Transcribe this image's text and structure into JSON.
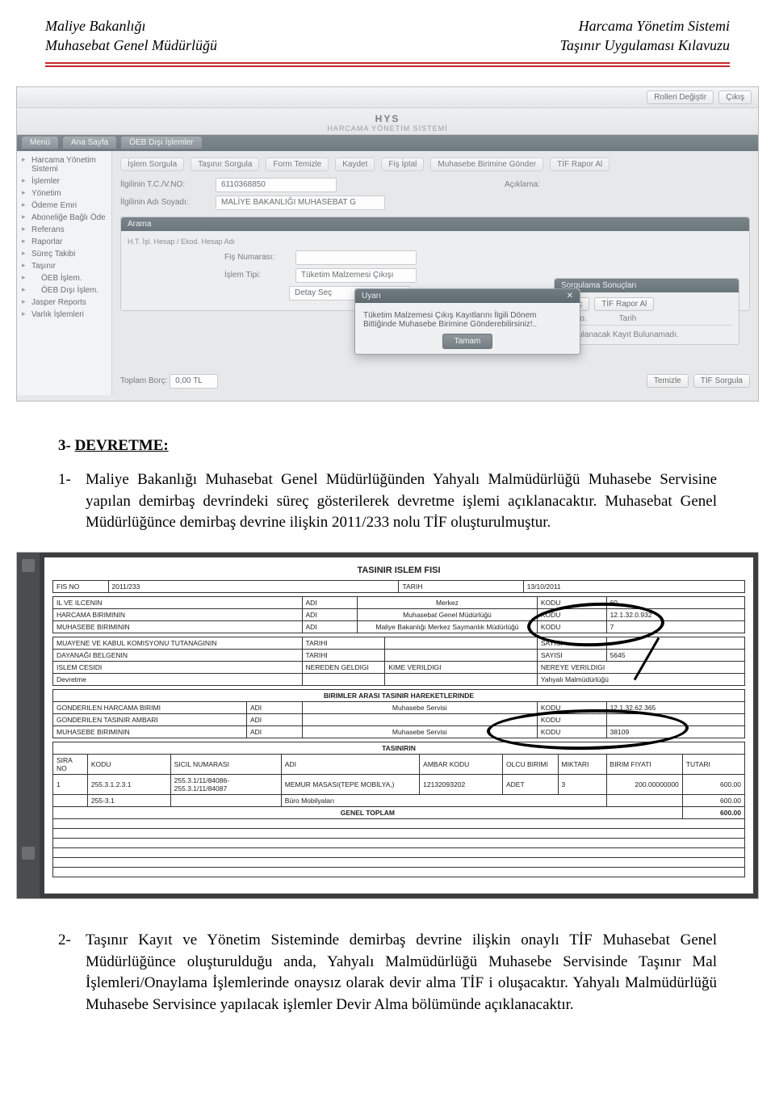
{
  "header": {
    "left1": "Maliye Bakanlığı",
    "left2": "Muhasebat Genel Müdürlüğü",
    "right1": "Harcama Yönetim Sistemi",
    "right2": "Taşınır Uygulaması Kılavuzu"
  },
  "app": {
    "brand_top": "HYS",
    "brand_sub": "HARCAMA YÖNETİM SİSTEMİ",
    "top_buttons": {
      "change_role": "Rolleri Değiştir",
      "exit": "Çıkış"
    },
    "tabs": {
      "menu": "Menü",
      "home": "Ana Sayfa",
      "oeb": "ÖEB Dışı İşlemler"
    },
    "sidebar": {
      "n1": "Harcama Yönetim Sistemi",
      "n2": "İşlemler",
      "n3": "Yönetim",
      "n4": "Ödeme Emri",
      "n5": "Aboneliğe Bağlı Öde",
      "n6": "Referans",
      "n7": "Raporlar",
      "n8": "Süreç Takibi",
      "n9": "Taşınır",
      "n10": "ÖEB İşlem.",
      "n11": "ÖEB Dışı İşlem.",
      "n12": "Jasper Reports",
      "n13": "Varlık İşlemleri"
    },
    "toolbar": {
      "t1": "İşlem Sorgula",
      "t2": "Taşınır Sorgula",
      "t3": "Form Temizle",
      "t4": "Kaydet",
      "t5": "Fiş İptal",
      "t6": "Muhasebe Birimine Gönder",
      "t7": "TİF Rapor Al"
    },
    "form": {
      "l_tc": "İlgilinin T.C./V.NO:",
      "v_tc": "6110368850",
      "l_aciklama": "Açıklama:",
      "l_adsoyad": "İlgilinin Adı Soyadı:",
      "v_adsoyad": "MALİYE BAKANLIĞI MUHASEBAT G"
    },
    "arama": {
      "hd": "Arama",
      "sub": "H.T.  İşl.  Hesap / Ekod.  Hesap Adı",
      "l_fisno": "Fiş Numarası:",
      "l_islem": "İşlem Tipi:",
      "v_islem": "Tüketim Malzemesi Çıkışı",
      "v_detay": "Detay Seç"
    },
    "sorgu": {
      "hd": "Sorgulama Sonuçları",
      "b_sec": "Seç",
      "b_rapor": "TİF Rapor Al",
      "c_fisno": "Fiş No.",
      "c_tarih": "Tarih",
      "no_result": "Sorgulanacak Kayıt Bulunamadı."
    },
    "modal": {
      "hd": "Uyarı",
      "msg": "Tüketim Malzemesi Çıkış Kayıtlarını İlgili Dönem Bittiğinde Muhasebe Birimine Gönderebilirsiniz!..",
      "ok": "Tamam"
    },
    "footer": {
      "l_borc": "Toplam Borç:",
      "v_borc": "0,00 TL",
      "b_temizle": "Temizle",
      "b_sorgula": "TİF Sorgula"
    }
  },
  "section_devretme": {
    "heading_num": "3-",
    "heading": "DEVRETME:",
    "p1_num": "1-",
    "p1": "Maliye Bakanlığı Muhasebat Genel Müdürlüğünden Yahyalı Malmüdürlüğü Muhasebe Servisine yapılan demirbaş devrindeki süreç gösterilerek devretme işlemi açıklanacaktır. Muhasebat Genel Müdürlüğünce demirbaş devrine ilişkin 2011/233 nolu TİF oluşturulmuştur."
  },
  "tif": {
    "title": "TASINIR ISLEM FISI",
    "l_fisno": "FIS NO",
    "v_fisno": "2011/233",
    "l_tarih": "TARIH",
    "v_tarih": "13/10/2011",
    "l_il": "IL VE ILCENIN",
    "l_harcama": "HARCAMA BIRIMININ",
    "l_muhbirim": "MUHASEBE BIRIMININ",
    "c_adi": "ADI",
    "c_kodu": "KODU",
    "v_il_adi": "Merkez",
    "v_il_kodu": "60",
    "v_harcama_adi": "Muhasebat Genel Müdürlüğü",
    "v_harcama_kodu": "12.1.32.0.932",
    "v_muh_adi": "Maliye Bakanlığı Merkez Saymanlık Müdürlüğü",
    "v_muh_kodu": "7",
    "l_muayene": "MUAYENE VE KABUL KOMISYONU TUTANAGININ",
    "l_dayanak": "DAYANAĞI BELGENIN",
    "c_tarihi": "TARIHI",
    "c_sayisi": "SAYISI",
    "v_sayisi": "5645",
    "l_islemcesidi": "ISLEM CESIDI",
    "l_nereden": "NEREDEN GELDIGI",
    "l_kime": "KIME VERILDIGI",
    "l_nereye": "NEREYE VERILDIGI",
    "v_islemcesidi": "Devretme",
    "v_nereye": "Yahyalı Malmüdürlüğü",
    "sect_birimler": "BIRIMLER ARASI TASINIR HAREKETLERINDE",
    "l_gond_harcama": "GONDERILEN HARCAMA BIRIMI",
    "l_gond_ambar": "GONDERILEN TASINIR AMBARI",
    "v_gond_harcama": "Muhasebe Servisi",
    "v_gond_harcama_kodu": "12.1.32.62.365",
    "v_gond_ambar": "Muhasebe Servisi",
    "v_gond_ambar_kodu": "38109",
    "sect_tasinirin": "TASINIRIN",
    "col_sira": "SIRA NO",
    "col_kodu": "KODU",
    "col_sicil": "SICIL NUMARASI",
    "col_adi": "ADI",
    "col_ambarkodu": "AMBAR KODU",
    "col_olcu": "OLCU BIRIMI",
    "col_miktari": "MIKTARI",
    "col_birimfiyat": "BIRIM FIYATI",
    "col_tutari": "TUTARI",
    "row1_sira": "1",
    "row1_kodu": "255.3.1.2.3.1",
    "row1_sicil": "255.3.1/11/84086-255.3.1/11/84087",
    "row1_adi": "MEMUR MASASI(TEPE MOBİLYA,)",
    "row1_ambar": "12132093202",
    "row1_olcu": "ADET",
    "row1_miktar": "3",
    "row1_fiyat": "200.00000000",
    "row1_tutar": "600.00",
    "row2_kodu": "255-3.1",
    "row2_adi": "Büro Mobilyaları",
    "row2_tutar": "600.00",
    "genel": "GENEL TOPLAM",
    "genel_tutar": "600.00"
  },
  "section_p2": {
    "num": "2-",
    "text": "Taşınır Kayıt ve Yönetim Sisteminde demirbaş devrine ilişkin onaylı TİF Muhasebat Genel Müdürlüğünce oluşturulduğu anda, Yahyalı Malmüdürlüğü Muhasebe Servisinde Taşınır Mal İşlemleri/Onaylama İşlemlerinde onaysız olarak devir alma TİF i oluşacaktır. Yahyalı Malmüdürlüğü Muhasebe Servisince yapılacak işlemler Devir Alma bölümünde açıklanacaktır."
  }
}
